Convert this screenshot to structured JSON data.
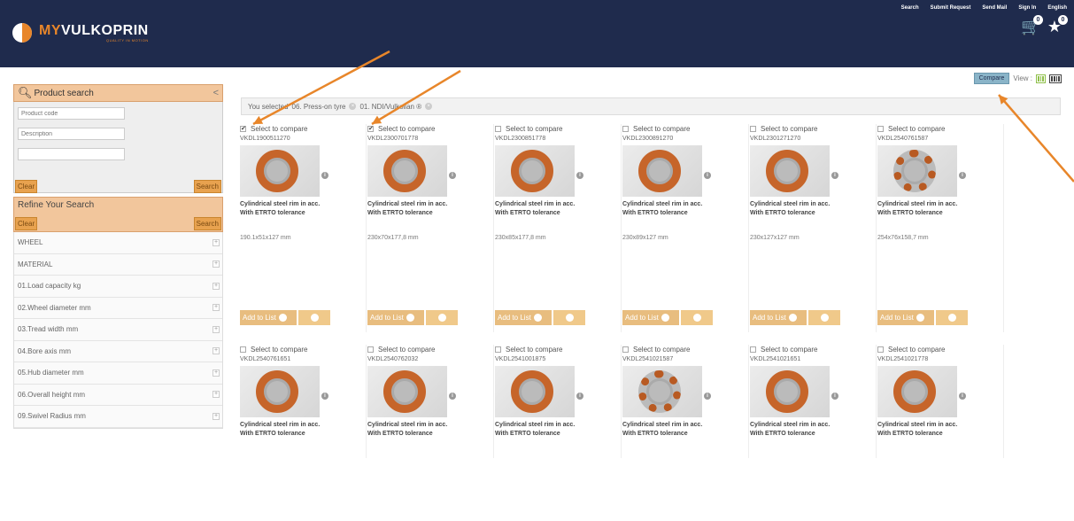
{
  "header": {
    "brand_prefix": "MY",
    "brand_name": "VULKOPRIN",
    "tagline": "QUALITY IN MOTION",
    "nav": [
      "Search",
      "Submit Request",
      "Send Mail",
      "Sign In",
      "English"
    ],
    "cart_count": "0",
    "wishlist_count": "0",
    "cart_icon": "cart-icon",
    "wishlist_icon": "star-icon"
  },
  "viewbar": {
    "compare_label": "Compare",
    "view_label": "View :"
  },
  "sidebar": {
    "search_title": "Product search",
    "product_code_placeholder": "Product code",
    "description_placeholder": "Description",
    "clear_label": "Clear",
    "search_label": "Search",
    "refine_title": "Refine Your Search",
    "filters": [
      "WHEEL",
      "MATERIAL",
      "01.Load capacity kg",
      "02.Wheel diameter mm",
      "03.Tread width mm",
      "04.Bore axis mm",
      "05.Hub diameter mm",
      "06.Overall height mm",
      "09.Swivel Radius mm"
    ]
  },
  "selection": {
    "prefix": "You selected",
    "items": [
      "06. Press-on tyre",
      "01. NDI/Vulkollan ®"
    ]
  },
  "products": {
    "compare_label": "Select to compare",
    "description_line1": "Cylindrical steel rim in acc.",
    "description_line2": "With ETRTO tolerance",
    "add_to_list_label": "Add to List",
    "row1": [
      {
        "code": "VKDL1900511270",
        "dims": "190.1x51x127 mm",
        "checked": true
      },
      {
        "code": "VKDL2300701778",
        "dims": "230x70x177,8 mm",
        "checked": true
      },
      {
        "code": "VKDL2300851778",
        "dims": "230x85x177,8 mm",
        "checked": false
      },
      {
        "code": "VKDL2300891270",
        "dims": "230x89x127 mm",
        "checked": false
      },
      {
        "code": "VKDL2301271270",
        "dims": "230x127x127 mm",
        "checked": false
      },
      {
        "code": "VKDL2540761587",
        "dims": "254x76x158,7 mm",
        "checked": false
      }
    ],
    "row2": [
      {
        "code": "VKDL2540761651",
        "checked": false
      },
      {
        "code": "VKDL2540762032",
        "checked": false
      },
      {
        "code": "VKDL2541001875",
        "checked": false
      },
      {
        "code": "VKDL2541021587",
        "checked": false
      },
      {
        "code": "VKDL2541021651",
        "checked": false
      },
      {
        "code": "VKDL2541021778",
        "checked": false
      }
    ]
  },
  "colors": {
    "header_bg": "#1f2b4d",
    "accent": "#e8862a",
    "arrow": "#e8862a"
  }
}
